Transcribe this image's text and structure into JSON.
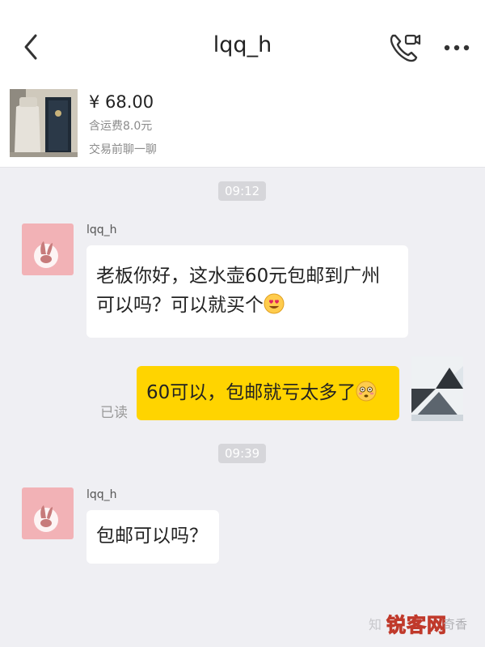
{
  "header": {
    "title": "lqq_h",
    "back_icon": "chevron-left-icon",
    "call_icon": "phone-video-icon",
    "more_icon": "more-dots-icon"
  },
  "product": {
    "price": "¥ 68.00",
    "shipping": "含运费8.0元",
    "chat_link": "交易前聊一聊"
  },
  "messages": {
    "time1": "09:12",
    "sender1": "lqq_h",
    "msg1_line1": "老板你好，这水壶60元包邮到广州",
    "msg1_line2": "可以吗？可以就买个",
    "my_msg": "60可以，包邮就亏太多了",
    "read_status": "已读",
    "time2": "09:39",
    "sender2": "lqq_h",
    "msg2": "包邮可以吗？"
  },
  "watermark": {
    "prefix": "知",
    "logo": "锐客网",
    "suffix": "奇香"
  },
  "colors": {
    "accent": "#ffd400",
    "background": "#efeff3",
    "avatar": "#f2b2b6"
  }
}
